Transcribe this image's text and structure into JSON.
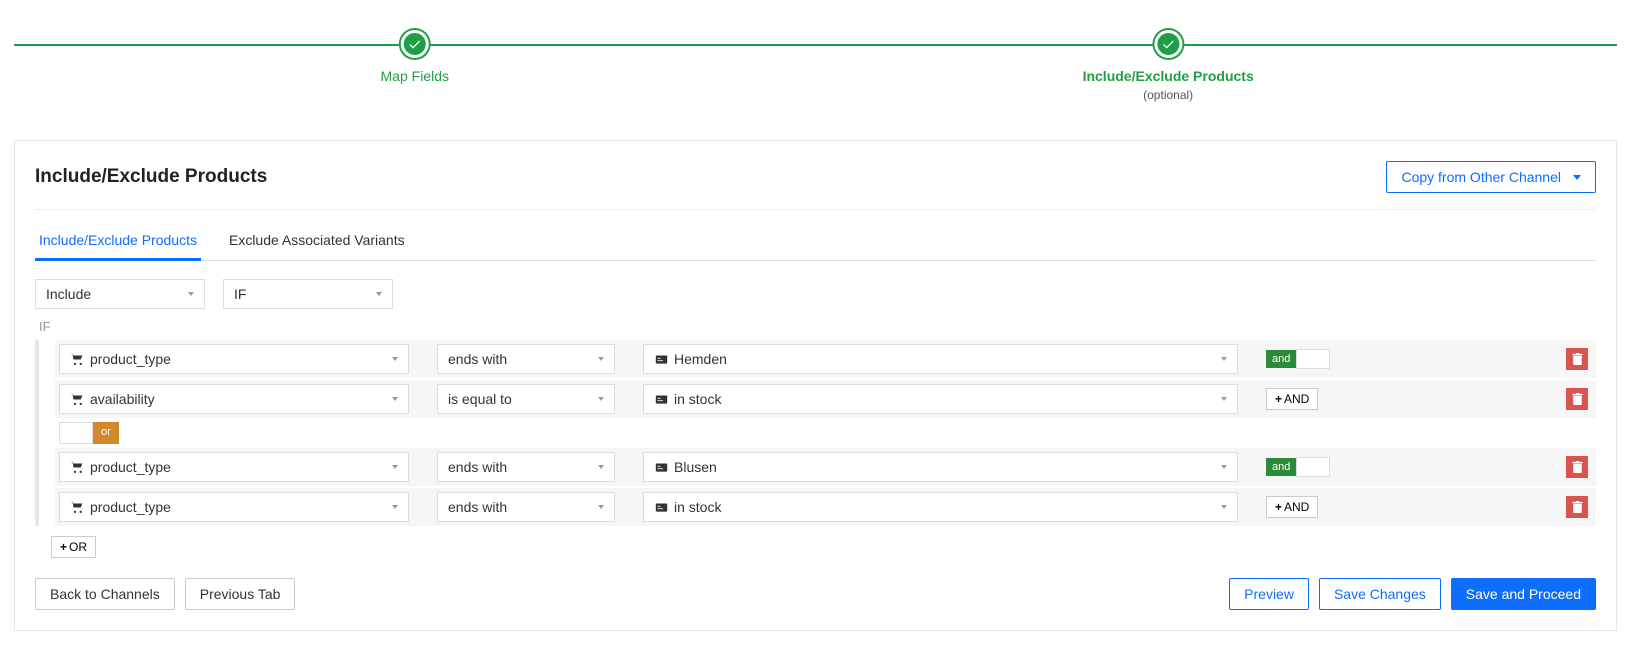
{
  "stepper": {
    "step1": {
      "label": "Map Fields"
    },
    "step2": {
      "label": "Include/Exclude Products",
      "sub": "(optional)"
    }
  },
  "panel": {
    "title": "Include/Exclude Products",
    "copy_btn": "Copy from Other Channel"
  },
  "tabs": {
    "t1": "Include/Exclude Products",
    "t2": "Exclude Associated Variants"
  },
  "top": {
    "mode": "Include",
    "cond": "IF",
    "if_label": "IF"
  },
  "rules": {
    "g1r1": {
      "field": "product_type",
      "op": "ends with",
      "val": "Hemden",
      "bool": "and"
    },
    "g1r2": {
      "field": "availability",
      "op": "is equal to",
      "val": "in stock"
    },
    "or_sep": "or",
    "g2r1": {
      "field": "product_type",
      "op": "ends with",
      "val": "Blusen",
      "bool": "and"
    },
    "g2r2": {
      "field": "product_type",
      "op": "ends with",
      "val": "in stock"
    }
  },
  "add": {
    "and": "AND",
    "or": "OR"
  },
  "footer": {
    "back": "Back to Channels",
    "prev": "Previous Tab",
    "preview": "Preview",
    "save": "Save Changes",
    "proceed": "Save and Proceed"
  }
}
